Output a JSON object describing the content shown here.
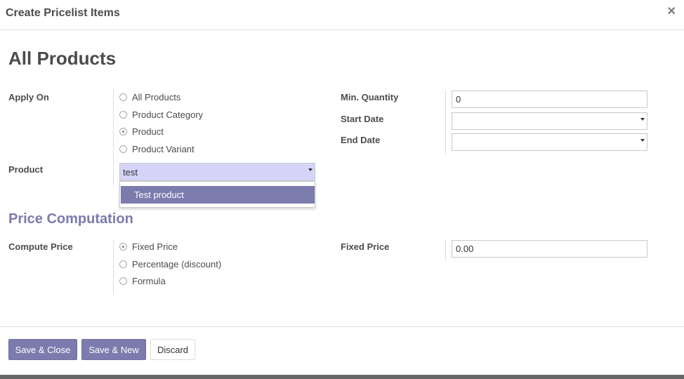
{
  "dialog": {
    "title": "Create Pricelist Items",
    "close_symbol": "×"
  },
  "record": {
    "title": "All Products"
  },
  "apply_on": {
    "label": "Apply On",
    "options": [
      "All Products",
      "Product Category",
      "Product",
      "Product Variant"
    ],
    "selected": "Product"
  },
  "product": {
    "label": "Product",
    "value": "test",
    "dropdown_items": [
      "Test product"
    ]
  },
  "min_quantity": {
    "label": "Min. Quantity",
    "value": "0"
  },
  "start_date": {
    "label": "Start Date",
    "value": ""
  },
  "end_date": {
    "label": "End Date",
    "value": ""
  },
  "price_computation": {
    "section_title": "Price Computation",
    "compute_label": "Compute Price",
    "options": [
      "Fixed Price",
      "Percentage (discount)",
      "Formula"
    ],
    "selected": "Fixed Price",
    "fixed_price_label": "Fixed Price",
    "fixed_price_value": "0.00"
  },
  "footer": {
    "save_close": "Save & Close",
    "save_new": "Save & New",
    "discard": "Discard"
  },
  "colors": {
    "accent": "#7c7bad",
    "highlight_field": "#d5d4f8"
  }
}
